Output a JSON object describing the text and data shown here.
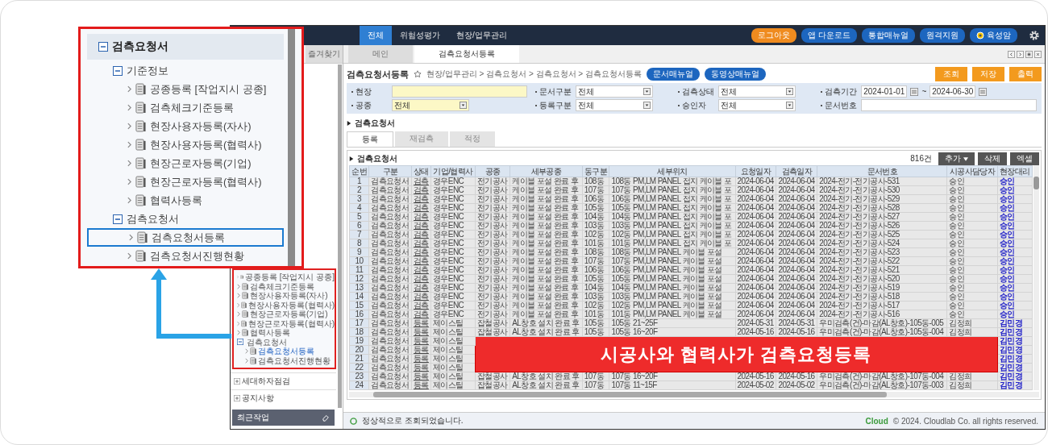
{
  "callout": {
    "tree": [
      {
        "label": "검측요청서",
        "expanded": true,
        "selected": false,
        "children": [
          {
            "label": "기준정보",
            "expanded": true,
            "selected": false,
            "children": [
              {
                "label": "공종등록 [작업지시 공종]",
                "selected": false
              },
              {
                "label": "검측체크기준등록",
                "selected": false
              },
              {
                "label": "현장사용자등록(자사)",
                "selected": false
              },
              {
                "label": "현장사용자등록(협력사)",
                "selected": false
              },
              {
                "label": "현장근로자등록(기업)",
                "selected": false
              },
              {
                "label": "현장근로자등록(협력사)",
                "selected": false
              },
              {
                "label": "협력사등록",
                "selected": false
              }
            ]
          },
          {
            "label": "검측요청서",
            "expanded": true,
            "selected": false,
            "children": [
              {
                "label": "검측요청서등록",
                "selected": true
              },
              {
                "label": "검측요청서진행현황",
                "selected": false
              }
            ]
          }
        ]
      }
    ]
  },
  "banner": "시공사와 협력사가 검측요청등록",
  "header": {
    "nav": [
      {
        "label": "전체",
        "selected": true
      },
      {
        "label": "위험성평가",
        "selected": false
      },
      {
        "label": "현장/업무관리",
        "selected": false
      }
    ],
    "logout": "로그아웃",
    "links": [
      "앱 다운로드",
      "통합매뉴얼",
      "원격지원"
    ],
    "user": "육성암"
  },
  "sidebar": {
    "tab": "즐겨찾기",
    "tree": [
      {
        "label": "공종등록 [작업지시 공종]",
        "selected": false
      },
      {
        "label": "검측체크기준등록",
        "selected": false
      },
      {
        "label": "현장사용자등록(자사)",
        "selected": false
      },
      {
        "label": "현장사용자등록(협력사)",
        "selected": false
      },
      {
        "label": "현장근로자등록(기업)",
        "selected": false
      },
      {
        "label": "현장근로자등록(협력사)",
        "selected": false
      },
      {
        "label": "협력사등록",
        "selected": false
      },
      {
        "label": "검측요청서",
        "expanded": true,
        "selected": false,
        "children": [
          {
            "label": "검측요청서등록",
            "selected": true
          },
          {
            "label": "검측요청서진행현황",
            "selected": false
          }
        ]
      }
    ],
    "sections": [
      {
        "label": "세대하자점검",
        "expanded": false
      },
      {
        "label": "공지사항",
        "expanded": false
      }
    ],
    "recent": "최근작업"
  },
  "page_tabs": [
    {
      "label": "메인",
      "selected": false
    },
    {
      "label": "검측요청서등록",
      "selected": true
    }
  ],
  "title": "검측요청서등록",
  "breadcrumb": "현장/업무관리 > 검측요청서 > 검측요청서 > 검측요청서등록",
  "manuals": [
    "문서매뉴얼",
    "동영상매뉴얼"
  ],
  "actions": [
    "조회",
    "저장",
    "출력"
  ],
  "filters": [
    {
      "label": "현장",
      "kind": "text",
      "required": true
    },
    {
      "label": "문서구분",
      "kind": "select",
      "value": "전체",
      "required": false
    },
    {
      "label": "검측상태",
      "kind": "select",
      "value": "전체",
      "required": false
    },
    {
      "label": "검측기간",
      "kind": "daterange",
      "from": "2024-01-01",
      "separator": "~",
      "to": "2024-06-30",
      "required": false
    },
    {
      "label": "공종",
      "kind": "select",
      "value": "전체",
      "required": true
    },
    {
      "label": "등록구분",
      "kind": "select",
      "value": "전체",
      "required": false
    },
    {
      "label": "승인자",
      "kind": "select",
      "value": "전체",
      "required": false
    },
    {
      "label": "문서번호",
      "kind": "text",
      "required": false
    }
  ],
  "section": "검측요청서",
  "sub_tabs": [
    {
      "label": "등록",
      "selected": true
    },
    {
      "label": "재검측",
      "selected": false
    },
    {
      "label": "적정",
      "selected": false
    }
  ],
  "table": {
    "title": "검측요청서",
    "count": "816건",
    "buttons": [
      "추가",
      "삭제",
      "엑셀"
    ],
    "columns": [
      {
        "label": "순번",
        "kind": "number"
      },
      {
        "label": "구분",
        "kind": "text"
      },
      {
        "label": "상태",
        "kind": "link"
      },
      {
        "label": "기업/협력사",
        "kind": "text"
      },
      {
        "label": "공종",
        "kind": "text"
      },
      {
        "label": "세부공종",
        "kind": "text"
      },
      {
        "label": "동구분",
        "kind": "text"
      },
      {
        "label": "세부위치",
        "kind": "text"
      },
      {
        "label": "요청일자",
        "kind": "text"
      },
      {
        "label": "검측일자",
        "kind": "text"
      },
      {
        "label": "문서번호",
        "kind": "text"
      },
      {
        "label": "시공사담당자",
        "kind": "text"
      },
      {
        "label": "현장대리",
        "kind": "approver"
      }
    ],
    "rows": [
      {
        "covered": false,
        "cells": [
          "1",
          "검측요청서",
          "검측",
          "경우ENC",
          "전기공사",
          "케이블 포설 완료 후",
          "108동",
          "108동 PM,LM PANEL 접지 케이블 포",
          "2024-06-04",
          "2024-06-04",
          "2024-전기-전기공사-531",
          "승인",
          "승인"
        ]
      },
      {
        "covered": false,
        "cells": [
          "2",
          "검측요청서",
          "검측",
          "경우ENC",
          "전기공사",
          "케이블 포설 완료 후",
          "107동",
          "107동 PM,LM PANEL 접지 케이블 포",
          "2024-06-04",
          "2024-06-04",
          "2024-전기-전기공사-530",
          "승인",
          "승인"
        ]
      },
      {
        "covered": false,
        "cells": [
          "3",
          "검측요청서",
          "검측",
          "경우ENC",
          "전기공사",
          "케이블 포설 완료 후",
          "106동",
          "106동 PM,LM PANEL 접지 케이블 포",
          "2024-06-04",
          "2024-06-04",
          "2024-전기-전기공사-529",
          "승인",
          "승인"
        ]
      },
      {
        "covered": false,
        "cells": [
          "4",
          "검측요청서",
          "검측",
          "경우ENC",
          "전기공사",
          "케이블 포설 완료 후",
          "105동",
          "105동 PM,LM PANEL 접지 케이블 포",
          "2024-06-04",
          "2024-06-04",
          "2024-전기-전기공사-528",
          "승인",
          "승인"
        ]
      },
      {
        "covered": false,
        "cells": [
          "5",
          "검측요청서",
          "검측",
          "경우ENC",
          "전기공사",
          "케이블 포설 완료 후",
          "104동",
          "104동 PM,LM PANEL 접지 케이블 포",
          "2024-06-04",
          "2024-06-04",
          "2024-전기-전기공사-527",
          "승인",
          "승인"
        ]
      },
      {
        "covered": false,
        "cells": [
          "6",
          "검측요청서",
          "검측",
          "경우ENC",
          "전기공사",
          "케이블 포설 완료 후",
          "103동",
          "103동 PM,LM PANEL 접지 케이블 포",
          "2024-06-04",
          "2024-06-04",
          "2024-전기-전기공사-526",
          "승인",
          "승인"
        ]
      },
      {
        "covered": false,
        "cells": [
          "7",
          "검측요청서",
          "검측",
          "경우ENC",
          "전기공사",
          "케이블 포설 완료 후",
          "102동",
          "102동 PM,LM PANEL 접지 케이블 포",
          "2024-06-04",
          "2024-06-04",
          "2024-전기-전기공사-525",
          "승인",
          "승인"
        ]
      },
      {
        "covered": false,
        "cells": [
          "8",
          "검측요청서",
          "검측",
          "경우ENC",
          "전기공사",
          "케이블 포설 완료 후",
          "101동",
          "101동 PM,LM PANEL 접지 케이블 포",
          "2024-06-04",
          "2024-06-04",
          "2024-전기-전기공사-524",
          "승인",
          "승인"
        ]
      },
      {
        "covered": false,
        "cells": [
          "9",
          "검측요청서",
          "검측",
          "경우ENC",
          "전기공사",
          "케이블 포설 완료 후",
          "108동",
          "108동 PM,LM PANEL 케이블 포설",
          "2024-06-04",
          "2024-06-04",
          "2024-전기-전기공사-523",
          "승인",
          "승인"
        ]
      },
      {
        "covered": false,
        "cells": [
          "10",
          "검측요청서",
          "검측",
          "경우ENC",
          "전기공사",
          "케이블 포설 완료 후",
          "107동",
          "107동 PM,LM PANEL 케이블 포설",
          "2024-06-04",
          "2024-06-04",
          "2024-전기-전기공사-522",
          "승인",
          "승인"
        ]
      },
      {
        "covered": false,
        "cells": [
          "11",
          "검측요청서",
          "검측",
          "경우ENC",
          "전기공사",
          "케이블 포설 완료 후",
          "106동",
          "106동 PM,LM PANEL 케이블 포설",
          "2024-06-04",
          "2024-06-04",
          "2024-전기-전기공사-521",
          "승인",
          "승인"
        ]
      },
      {
        "covered": false,
        "cells": [
          "12",
          "검측요청서",
          "검측",
          "경우ENC",
          "전기공사",
          "케이블 포설 완료 후",
          "105동",
          "105동 PM,LM PANEL 케이블 포설",
          "2024-06-04",
          "2024-06-04",
          "2024-전기-전기공사-520",
          "승인",
          "승인"
        ]
      },
      {
        "covered": false,
        "cells": [
          "13",
          "검측요청서",
          "검측",
          "경우ENC",
          "전기공사",
          "케이블 포설 완료 후",
          "104동",
          "104동 PM,LM PANEL 케이블 포설",
          "2024-06-04",
          "2024-06-04",
          "2024-전기-전기공사-519",
          "승인",
          "승인"
        ]
      },
      {
        "covered": false,
        "cells": [
          "14",
          "검측요청서",
          "검측",
          "경우ENC",
          "전기공사",
          "케이블 포설 완료 후",
          "103동",
          "103동 PM,LM PANEL 케이블 포설",
          "2024-06-04",
          "2024-06-04",
          "2024-전기-전기공사-518",
          "승인",
          "승인"
        ]
      },
      {
        "covered": false,
        "cells": [
          "15",
          "검측요청서",
          "검측",
          "경우ENC",
          "전기공사",
          "케이블 포설 완료 후",
          "102동",
          "102동 PM,LM PANEL 케이블 포설",
          "2024-06-04",
          "2024-06-04",
          "2024-전기-전기공사-517",
          "승인",
          "승인"
        ]
      },
      {
        "covered": false,
        "cells": [
          "16",
          "검측요청서",
          "검측",
          "경우ENC",
          "전기공사",
          "케이블 포설 완료 후",
          "101동",
          "101동 PM,LM PANEL 케이블 포설",
          "2024-06-04",
          "2024-06-04",
          "2024-전기-전기공사-516",
          "승인",
          "승인"
        ]
      },
      {
        "covered": false,
        "cells": [
          "17",
          "검측요청서",
          "등록",
          "제이스틸",
          "잡철공사",
          "AL창호 설치 완료 후",
          "105동",
          "105동 21~25F",
          "2024-05-31",
          "2024-05-31",
          "우미검측(건)-마감(AL창호)-105동-005",
          "김정희",
          "김민경"
        ]
      },
      {
        "covered": false,
        "cells": [
          "18",
          "검측요청서",
          "등록",
          "제이스틸",
          "잡철공사",
          "AL창호 설치 완료 후",
          "105동",
          "105동 16~20F",
          "2024-05-16",
          "2024-05-16",
          "우미검측(건)-마감(AL창호)-105동-004",
          "김정희",
          "김민경"
        ]
      },
      {
        "covered": true,
        "cells": [
          "19",
          "검측요청서",
          "등록",
          "제이스틸",
          "김민경"
        ]
      },
      {
        "covered": true,
        "cells": [
          "20",
          "검측요청서",
          "등록",
          "제이스틸",
          "김민경"
        ]
      },
      {
        "covered": true,
        "cells": [
          "21",
          "검측요청서",
          "등록",
          "제이스틸",
          "김민경"
        ]
      },
      {
        "covered": true,
        "cells": [
          "22",
          "검측요청서",
          "등록",
          "제이스틸",
          "김민경"
        ]
      },
      {
        "covered": false,
        "cells": [
          "23",
          "검측요청서",
          "등록",
          "제이스틸",
          "잡철공사",
          "AL창호 설치 완료 후",
          "107동",
          "107동 16~20F",
          "2024-05-16",
          "2024-05-16",
          "우미검측(건)-마감(AL창호)-107동-004",
          "김정희",
          "김민경"
        ]
      },
      {
        "covered": false,
        "cells": [
          "24",
          "검측요청서",
          "등록",
          "제이스틸",
          "잡철공사",
          "AL창호 설치 완료 후",
          "107동",
          "107동 11~15F",
          "2024-05-02",
          "2024-05-02",
          "우미검측(건)-마감(AL창호)-107동-003",
          "김정희",
          "김민경"
        ]
      }
    ]
  },
  "status": "정상적으로 조회되었습니다.",
  "footer": {
    "logo": "Cloud",
    "copyright": "© 2024. Cloudlab Co. all rights reserved."
  }
}
